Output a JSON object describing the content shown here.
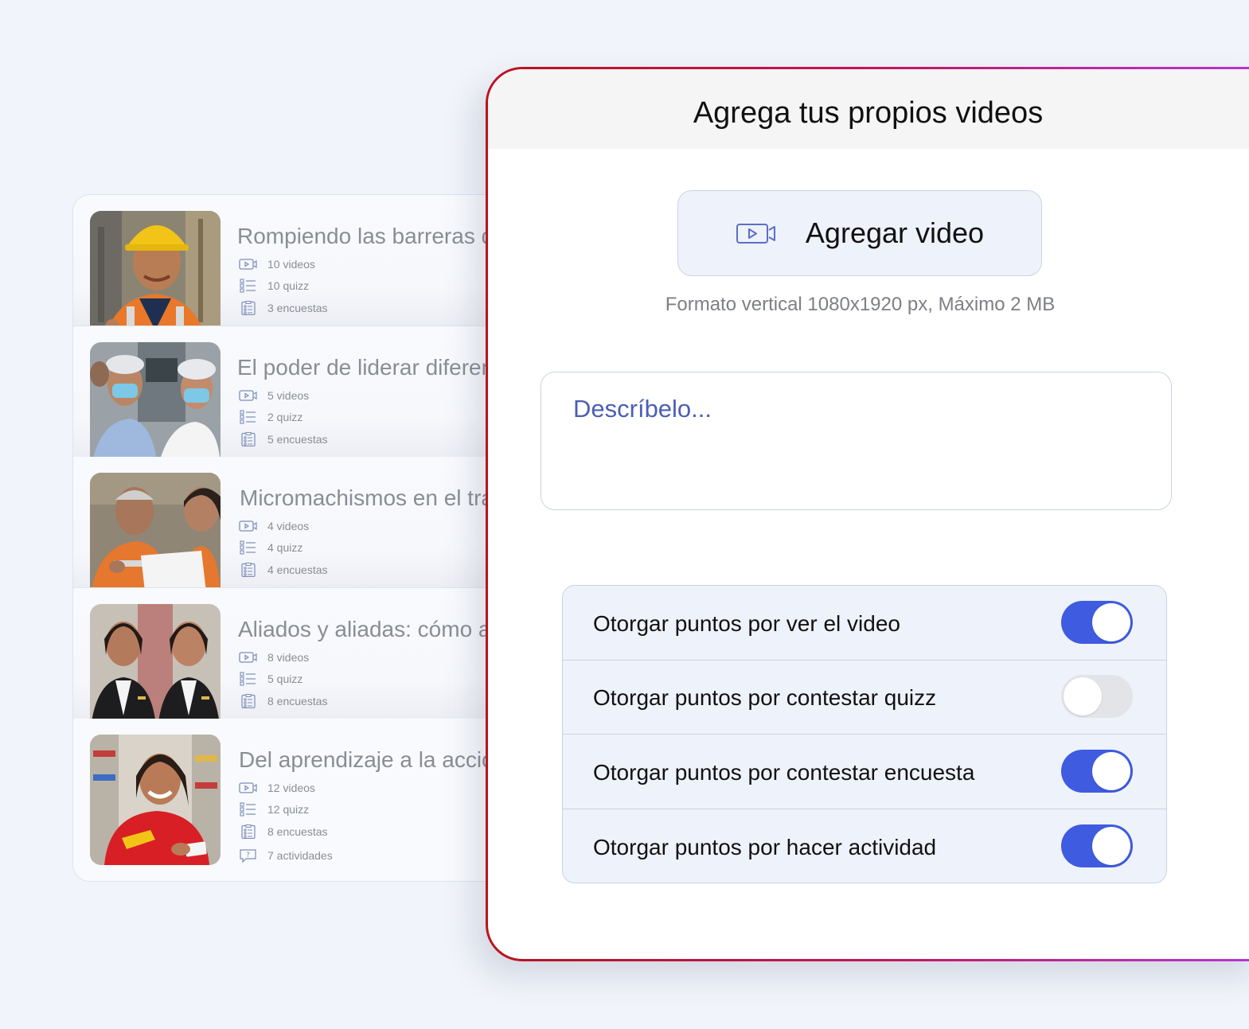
{
  "courses": [
    {
      "title": "Rompiendo las barreras de",
      "videos": "10 videos",
      "quizz": "10 quizz",
      "encuestas": "3 encuestas"
    },
    {
      "title": "El poder de liderar diferente",
      "videos": "5 videos",
      "quizz": "2 quizz",
      "encuestas": "5 encuestas"
    },
    {
      "title": "Micromachismos en el trabajo",
      "videos": "4 videos",
      "quizz": "4 quizz",
      "encuestas": "4 encuestas"
    },
    {
      "title": "Aliados y aliadas: cómo actuar",
      "videos": "8 videos",
      "quizz": "5 quizz",
      "encuestas": "8 encuestas"
    },
    {
      "title": "Del aprendizaje a la acción",
      "videos": "12 videos",
      "quizz": "12 quizz",
      "encuestas": "8 encuestas",
      "actividades": "7 actividades"
    }
  ],
  "modal": {
    "title": "Agrega tus propios videos",
    "add_video_label": "Agregar video",
    "format_note": "Formato vertical 1080x1920 px, Máximo 2 MB",
    "description_placeholder": "Descríbelo...",
    "toggles": [
      {
        "label": "Otorgar puntos por ver el video",
        "on": true
      },
      {
        "label": "Otorgar puntos por contestar quizz",
        "on": false
      },
      {
        "label": "Otorgar puntos por contestar encuesta",
        "on": true
      },
      {
        "label": "Otorgar puntos por hacer actividad",
        "on": true
      }
    ]
  },
  "colors": {
    "toggle_on": "#3f5be0",
    "toggle_off": "#e2e4e8",
    "placeholder": "#4c5eb6",
    "modal_border_start": "#b8141f",
    "modal_border_end": "#b737d8"
  },
  "icons": [
    "video-icon",
    "quiz-list-icon",
    "survey-clipboard-icon",
    "activity-question-icon",
    "add-video-icon"
  ]
}
